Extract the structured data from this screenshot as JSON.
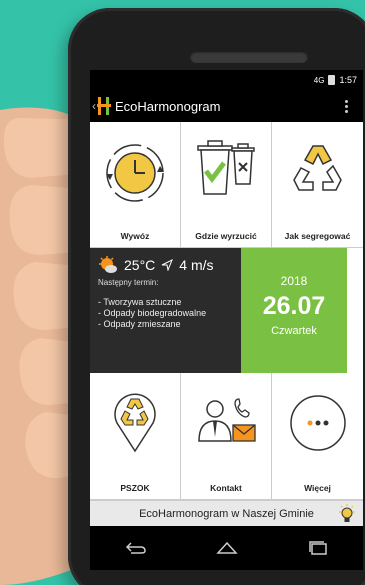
{
  "status_bar": {
    "signal": "4G",
    "time": "1:57"
  },
  "app_bar": {
    "title": "EcoHarmonogram",
    "back_icon": "chevron-left-icon",
    "menu_icon": "overflow-menu-icon"
  },
  "tiles_top": [
    {
      "label": "Wywóz",
      "icon": "clock-recycle-icon"
    },
    {
      "label": "Gdzie wyrzucić",
      "icon": "trash-bins-icon"
    },
    {
      "label": "Jak segregować",
      "icon": "recycle-arrows-icon"
    }
  ],
  "weather": {
    "temperature": "25°C",
    "wind": "4 m/s",
    "next_label": "Następny termin:",
    "items": [
      "- Tworzywa sztuczne",
      "- Odpady biodegradowalne",
      "- Odpady zmieszane"
    ]
  },
  "date_box": {
    "year": "2018",
    "date": "26.07",
    "weekday": "Czwartek"
  },
  "tiles_bottom": [
    {
      "label": "PSZOK",
      "icon": "location-recycle-icon"
    },
    {
      "label": "Kontakt",
      "icon": "contact-person-icon"
    },
    {
      "label": "Więcej",
      "icon": "more-dots-icon"
    }
  ],
  "footer": {
    "text": "EcoHarmonogram w Naszej Gminie",
    "icon": "lightbulb-icon"
  },
  "colors": {
    "background": "#34c3a8",
    "accent_green": "#7ac143",
    "dark_panel": "#2b2b2b",
    "clock_yellow": "#f2c744",
    "logo_orange": "#f7941d"
  }
}
